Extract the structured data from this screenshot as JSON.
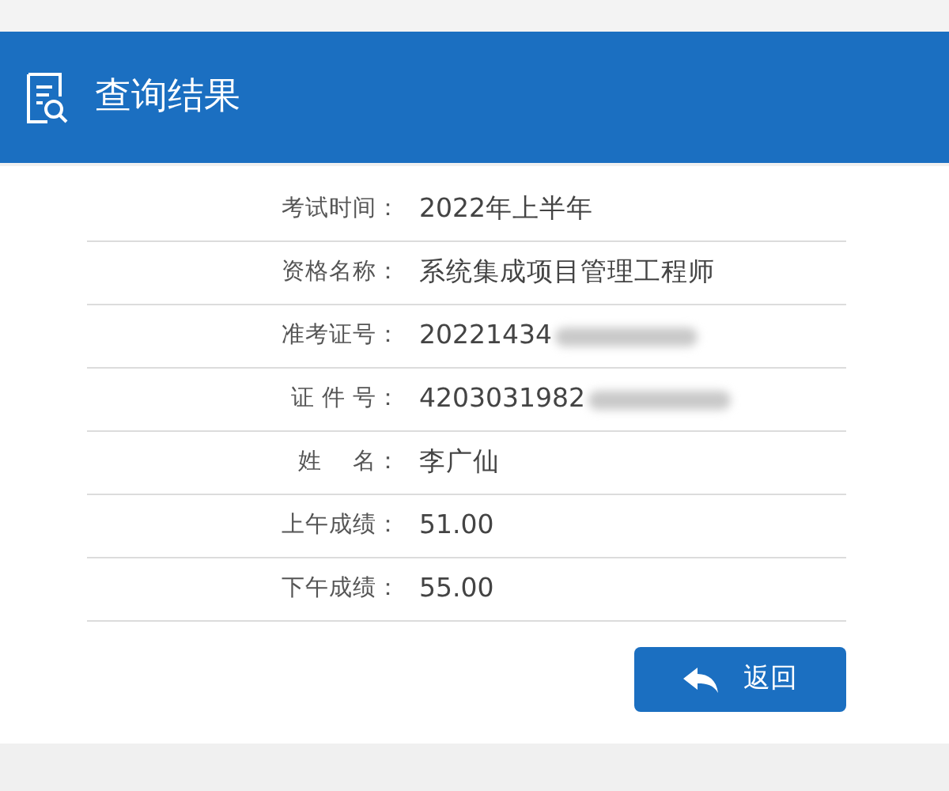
{
  "header": {
    "title": "查询结果"
  },
  "rows": [
    {
      "label": "考试时间：",
      "value": "2022年上半年",
      "redacted": false
    },
    {
      "label": "资格名称：",
      "value": "系统集成项目管理工程师",
      "redacted": false
    },
    {
      "label": "准考证号：",
      "value": "20221434",
      "redacted": true
    },
    {
      "label": "证 件 号：",
      "value": "4203031982",
      "redacted": true
    },
    {
      "label": "姓　 名：",
      "value": "李广仙",
      "redacted": false
    },
    {
      "label": "上午成绩：",
      "value": "51.00",
      "redacted": false
    },
    {
      "label": "下午成绩：",
      "value": "55.00",
      "redacted": false
    }
  ],
  "back_button": {
    "label": "返回"
  }
}
